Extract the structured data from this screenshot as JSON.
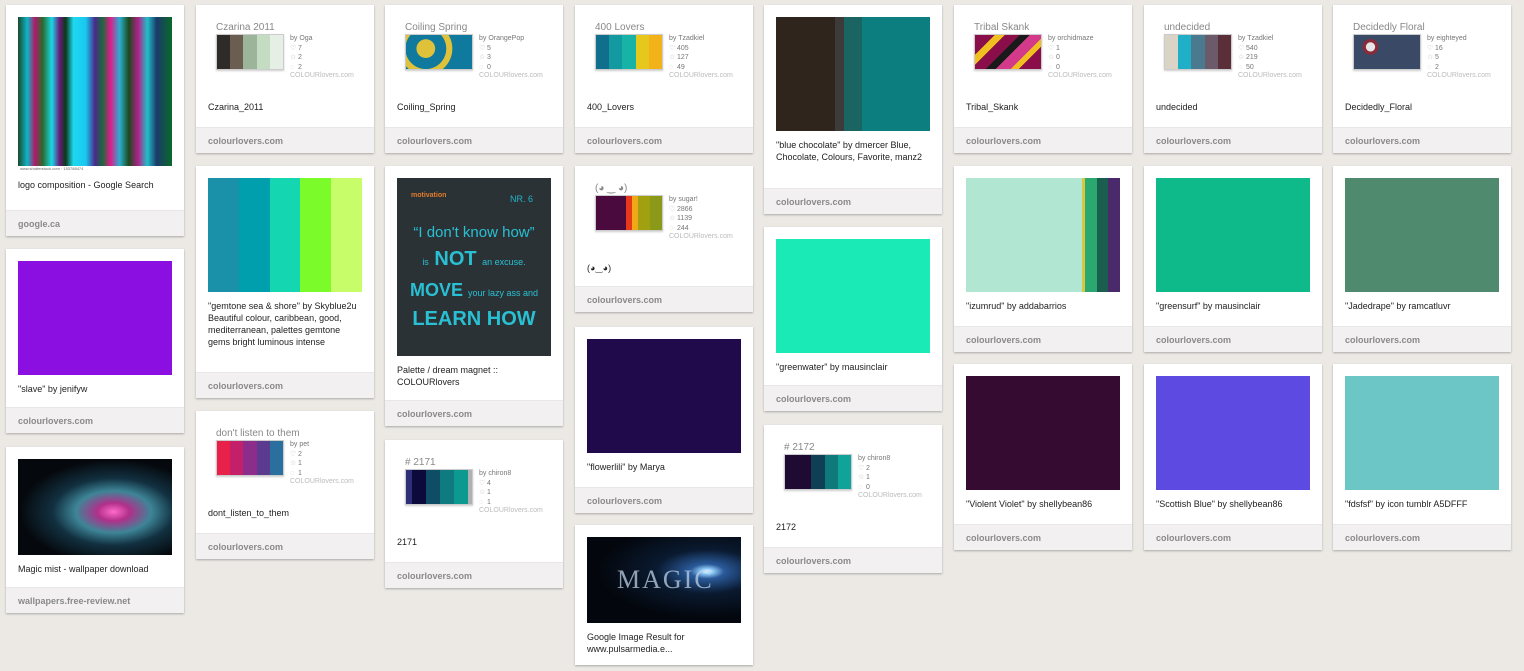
{
  "pins": [
    {
      "id": "p1",
      "desc": "logo composition - Google Search",
      "source": "google.ca",
      "image": "abstract-colorful-stripes",
      "watermark": "www.shutterstock.com · 153788474"
    },
    {
      "id": "p2",
      "desc": "\"slave\" by jenifyw",
      "source": "colourlovers.com",
      "color": "#8a0fe0"
    },
    {
      "id": "p3",
      "desc": "Magic mist - wallpaper download",
      "source": "wallpapers.free-review.net",
      "image": "dark-pink-teal-smoke"
    },
    {
      "id": "p4",
      "desc": "Czarina_2011",
      "source": "colourlovers.com",
      "widget": {
        "title": "Czarina 2011",
        "by": "by Oga",
        "hearts": "7",
        "stars": "2",
        "comments": "2",
        "brand": "COLOURlovers.com",
        "colors": [
          "#2f2b28",
          "#6b5e50",
          "#9cb59a",
          "#c4dcc2",
          "#e6efe6"
        ]
      }
    },
    {
      "id": "p5",
      "desc": "\"gemtone sea & shore\" by Skyblue2u Beautiful colour, caribbean, good, mediterranean, palettes gemtone gems bright luminous intense",
      "source": "colourlovers.com",
      "colors": [
        "#1a91a8",
        "#009fae",
        "#14d6b0",
        "#7cfb2a",
        "#c8fd6a"
      ]
    },
    {
      "id": "p6",
      "desc": "dont_listen_to_them",
      "source": "colourlovers.com",
      "widget": {
        "title": "don't listen to them",
        "by": "by pet",
        "hearts": "2",
        "stars": "1",
        "comments": "1",
        "brand": "COLOURlovers.com",
        "colors": [
          "#e8214a",
          "#c4206a",
          "#8c2d8c",
          "#5b3a90",
          "#2a6f9e"
        ]
      }
    },
    {
      "id": "p7",
      "desc": "Coiling_Spring",
      "source": "colourlovers.com",
      "widget": {
        "title": "Coiling Spring",
        "by": "by OrangePop",
        "hearts": "5",
        "stars": "3",
        "comments": "0",
        "brand": "COLOURlovers.com",
        "colors": [
          "#0f7a9e",
          "#e0c23a",
          "#0f7a9e",
          "#e0c23a"
        ]
      }
    },
    {
      "id": "p8",
      "desc": "Palette / dream magnet :: COLOURlovers",
      "source": "colourlovers.com",
      "poster": {
        "hdr": "motivation",
        "hdr2": "NR. 6",
        "l1": "“I don't know how”",
        "l2a": "is",
        "l2b": "NOT",
        "l2c": "an excuse.",
        "l3a": "MOVE",
        "l3b": "your lazy ass and",
        "l4": "LEARN HOW"
      }
    },
    {
      "id": "p9",
      "desc": "2171",
      "source": "colourlovers.com",
      "widget": {
        "title": "# 2171",
        "by": "by chiron8",
        "hearts": "4",
        "stars": "1",
        "comments": "1",
        "brand": "COLOURlovers.com",
        "colors": [
          "#2e2e7a",
          "#0c0a3a",
          "#0f4d66",
          "#0f7a80",
          "#0c9a90",
          "#b0b0b0"
        ]
      }
    },
    {
      "id": "p10",
      "desc": "400_Lovers",
      "source": "colourlovers.com",
      "widget": {
        "title": "400 Lovers",
        "by": "by Tzadkiel",
        "hearts": "405",
        "stars": "127",
        "comments": "49",
        "brand": "COLOURlovers.com",
        "colors": [
          "#0f6f8c",
          "#139aa0",
          "#16b3a6",
          "#e6c81c",
          "#f2b21a"
        ]
      }
    },
    {
      "id": "p11",
      "desc": "(◕‿◕)",
      "source": "colourlovers.com",
      "widget": {
        "title": "(◕ ‿ ◕)",
        "by": "by sugar!",
        "hearts": "2866",
        "stars": "1139",
        "comments": "244",
        "brand": "COLOURlovers.com",
        "colors": [
          "#4a0a3e",
          "#4a0a3e",
          "#e8381a",
          "#f0a818",
          "#a0a010",
          "#8a9a18"
        ]
      }
    },
    {
      "id": "p12",
      "desc": "\"flowerlili\" by Marya",
      "source": "colourlovers.com",
      "color": "#200a4b"
    },
    {
      "id": "p13",
      "desc": "Google Image Result for www.pulsarmedia.e...",
      "source": "",
      "image": "magic-dark-blue",
      "logoText": "MAGIC"
    },
    {
      "id": "p14",
      "desc": "\"blue chocolate\" by dmercer Blue, Chocolate, Colours, Favorite, manz2",
      "source": "colourlovers.com",
      "colors": [
        "#2f251c",
        "#2f251c",
        "#3c3b3a",
        "#1a6462",
        "#0d7e80",
        "#0d7e80"
      ]
    },
    {
      "id": "p15",
      "desc": "\"greenwater\" by mausinclair",
      "source": "colourlovers.com",
      "color": "#1aebb6"
    },
    {
      "id": "p16",
      "desc": "2172",
      "source": "colourlovers.com",
      "widget": {
        "title": "# 2172",
        "by": "by chiron8",
        "hearts": "2",
        "stars": "1",
        "comments": "0",
        "brand": "COLOURlovers.com",
        "colors": [
          "#1f0a33",
          "#1f0a33",
          "#0e3f55",
          "#0f7a7c",
          "#0fa39a"
        ]
      }
    },
    {
      "id": "p17",
      "desc": "Tribal_Skank",
      "source": "colourlovers.com",
      "widget": {
        "title": "Tribal Skank",
        "by": "by orchidmaze",
        "hearts": "1",
        "stars": "0",
        "comments": "0",
        "brand": "COLOURlovers.com",
        "colors": [
          "#8a0e4a",
          "#f0c020",
          "#1a1a1a",
          "#d43a8a"
        ]
      }
    },
    {
      "id": "p18",
      "desc": "\"izumrud\" by addabarrios",
      "source": "colourlovers.com",
      "colors": [
        "#b1e6d3",
        "#b1e6d3",
        "#b1e6d3",
        "#b1e6d3",
        "#b1e6d3",
        "#2aa870",
        "#1a5e50",
        "#4a2a6a"
      ]
    },
    {
      "id": "p19",
      "desc": "\"Violent Violet\" by shellybean86",
      "source": "colourlovers.com",
      "color": "#360b31"
    },
    {
      "id": "p20",
      "desc": "undecided",
      "source": "colourlovers.com",
      "widget": {
        "title": "undecided",
        "by": "by Tzadkiel",
        "hearts": "540",
        "stars": "219",
        "comments": "50",
        "brand": "COLOURlovers.com",
        "colors": [
          "#d9d4c6",
          "#1fb0c8",
          "#4a7a90",
          "#6a5a6a",
          "#5a2f3a"
        ]
      }
    },
    {
      "id": "p21",
      "desc": "\"greensurf\" by mausinclair",
      "source": "colourlovers.com",
      "color": "#0eb98a"
    },
    {
      "id": "p22",
      "desc": "\"Scottish Blue\" by shellybean86",
      "source": "colourlovers.com",
      "color": "#5c4ae1"
    },
    {
      "id": "p23",
      "desc": "Decidedly_Floral",
      "source": "colourlovers.com",
      "widget": {
        "title": "Decidedly Floral",
        "by": "by eighteyed",
        "hearts": "16",
        "stars": "5",
        "comments": "2",
        "brand": "COLOURlovers.com",
        "colors": [
          "#3a4a66",
          "#c8d2dc",
          "#8a2a3a",
          "#e6e6e6"
        ]
      }
    },
    {
      "id": "p24",
      "desc": "\"Jadedrape\" by ramcatluvr",
      "source": "colourlovers.com",
      "color": "#4f8a6e"
    },
    {
      "id": "p25",
      "desc": "\"fdsfsf\" by icon tumblr A5DFFF",
      "source": "colourlovers.com",
      "color": "#6cc6c6"
    }
  ]
}
